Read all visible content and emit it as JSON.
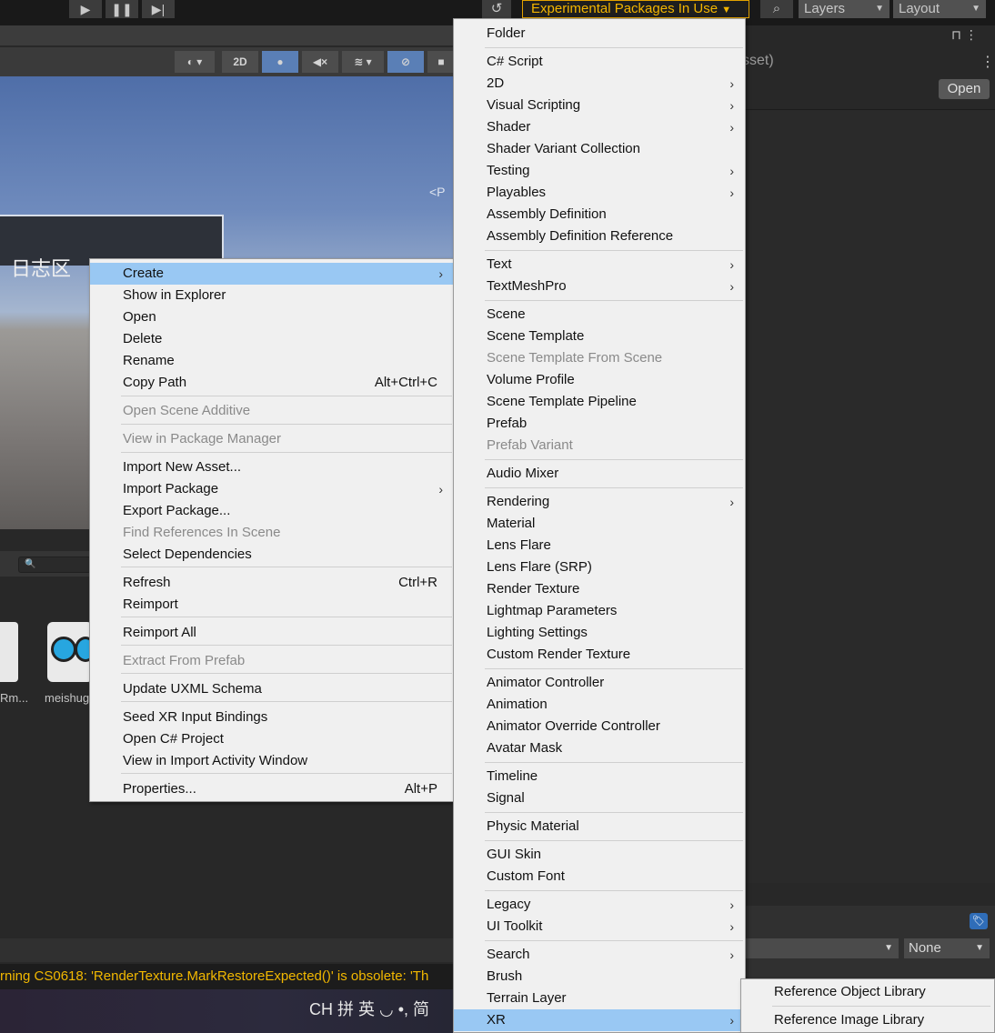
{
  "toolbar": {
    "play_icon": "play-icon",
    "pause_icon": "pause-icon",
    "step_icon": "step-icon",
    "play_glyph": "▶",
    "pause_glyph": "❚❚",
    "step_glyph": "▶|",
    "history_glyph": "↺",
    "experimental_label": "Experimental Packages In Use",
    "search_glyph": "⌕",
    "layers_label": "Layers",
    "layout_label": "Layout",
    "dropdown_arrow": "▼"
  },
  "scene_toolbar": {
    "button_2d": "2D"
  },
  "scene": {
    "label": "日志区",
    "gizmo_label": "<P"
  },
  "project": {
    "search_glyph": "🔍",
    "asset_names": [
      "Rm...",
      "meishug"
    ]
  },
  "console": {
    "message": "rning CS0618: 'RenderTexture.MarkRestoreExpected()' is obsolete: 'Th"
  },
  "ime": {
    "text": "CH 拼 英 ◡ •, 简"
  },
  "inspector": {
    "title_fragment": "sset)",
    "open_button": "Open",
    "tag_glyph": "🏷",
    "none_label": "None"
  },
  "context_menu": {
    "items": [
      {
        "label": "Create",
        "shortcut": "",
        "submenu": true,
        "disabled": false,
        "highlighted": true
      },
      {
        "label": "Show in Explorer",
        "shortcut": "",
        "submenu": false,
        "disabled": false
      },
      {
        "label": "Open",
        "shortcut": "",
        "submenu": false,
        "disabled": false
      },
      {
        "label": "Delete",
        "shortcut": "",
        "submenu": false,
        "disabled": false
      },
      {
        "label": "Rename",
        "shortcut": "",
        "submenu": false,
        "disabled": false
      },
      {
        "label": "Copy Path",
        "shortcut": "Alt+Ctrl+C",
        "submenu": false,
        "disabled": false
      },
      {
        "label": "Open Scene Additive",
        "shortcut": "",
        "submenu": false,
        "disabled": true
      },
      {
        "label": "View in Package Manager",
        "shortcut": "",
        "submenu": false,
        "disabled": true
      },
      {
        "label": "Import New Asset...",
        "shortcut": "",
        "submenu": false,
        "disabled": false
      },
      {
        "label": "Import Package",
        "shortcut": "",
        "submenu": true,
        "disabled": false
      },
      {
        "label": "Export Package...",
        "shortcut": "",
        "submenu": false,
        "disabled": false
      },
      {
        "label": "Find References In Scene",
        "shortcut": "",
        "submenu": false,
        "disabled": true
      },
      {
        "label": "Select Dependencies",
        "shortcut": "",
        "submenu": false,
        "disabled": false
      },
      {
        "label": "Refresh",
        "shortcut": "Ctrl+R",
        "submenu": false,
        "disabled": false
      },
      {
        "label": "Reimport",
        "shortcut": "",
        "submenu": false,
        "disabled": false
      },
      {
        "label": "Reimport All",
        "shortcut": "",
        "submenu": false,
        "disabled": false
      },
      {
        "label": "Extract From Prefab",
        "shortcut": "",
        "submenu": false,
        "disabled": true
      },
      {
        "label": "Update UXML Schema",
        "shortcut": "",
        "submenu": false,
        "disabled": false
      },
      {
        "label": "Seed XR Input Bindings",
        "shortcut": "",
        "submenu": false,
        "disabled": false
      },
      {
        "label": "Open C# Project",
        "shortcut": "",
        "submenu": false,
        "disabled": false
      },
      {
        "label": "View in Import Activity Window",
        "shortcut": "",
        "submenu": false,
        "disabled": false
      },
      {
        "label": "Properties...",
        "shortcut": "Alt+P",
        "submenu": false,
        "disabled": false
      }
    ],
    "submenu_glyph": "›"
  },
  "create_menu": {
    "items": [
      {
        "label": "Folder"
      },
      {
        "label": "C# Script"
      },
      {
        "label": "2D",
        "submenu": true
      },
      {
        "label": "Visual Scripting",
        "submenu": true
      },
      {
        "label": "Shader",
        "submenu": true
      },
      {
        "label": "Shader Variant Collection"
      },
      {
        "label": "Testing",
        "submenu": true
      },
      {
        "label": "Playables",
        "submenu": true
      },
      {
        "label": "Assembly Definition"
      },
      {
        "label": "Assembly Definition Reference"
      },
      {
        "label": "Text",
        "submenu": true
      },
      {
        "label": "TextMeshPro",
        "submenu": true
      },
      {
        "label": "Scene"
      },
      {
        "label": "Scene Template"
      },
      {
        "label": "Scene Template From Scene",
        "disabled": true
      },
      {
        "label": "Volume Profile"
      },
      {
        "label": "Scene Template Pipeline"
      },
      {
        "label": "Prefab"
      },
      {
        "label": "Prefab Variant",
        "disabled": true
      },
      {
        "label": "Audio Mixer"
      },
      {
        "label": "Rendering",
        "submenu": true
      },
      {
        "label": "Material"
      },
      {
        "label": "Lens Flare"
      },
      {
        "label": "Lens Flare (SRP)"
      },
      {
        "label": "Render Texture"
      },
      {
        "label": "Lightmap Parameters"
      },
      {
        "label": "Lighting Settings"
      },
      {
        "label": "Custom Render Texture"
      },
      {
        "label": "Animator Controller"
      },
      {
        "label": "Animation"
      },
      {
        "label": "Animator Override Controller"
      },
      {
        "label": "Avatar Mask"
      },
      {
        "label": "Timeline"
      },
      {
        "label": "Signal"
      },
      {
        "label": "Physic Material"
      },
      {
        "label": "GUI Skin"
      },
      {
        "label": "Custom Font"
      },
      {
        "label": "Legacy",
        "submenu": true
      },
      {
        "label": "UI Toolkit",
        "submenu": true
      },
      {
        "label": "Search",
        "submenu": true
      },
      {
        "label": "Brush"
      },
      {
        "label": "Terrain Layer"
      },
      {
        "label": "XR",
        "submenu": true,
        "highlighted": true
      }
    ]
  },
  "xr_menu": {
    "items": [
      {
        "label": "Reference Object Library"
      },
      {
        "label": "Reference Image Library"
      }
    ]
  }
}
